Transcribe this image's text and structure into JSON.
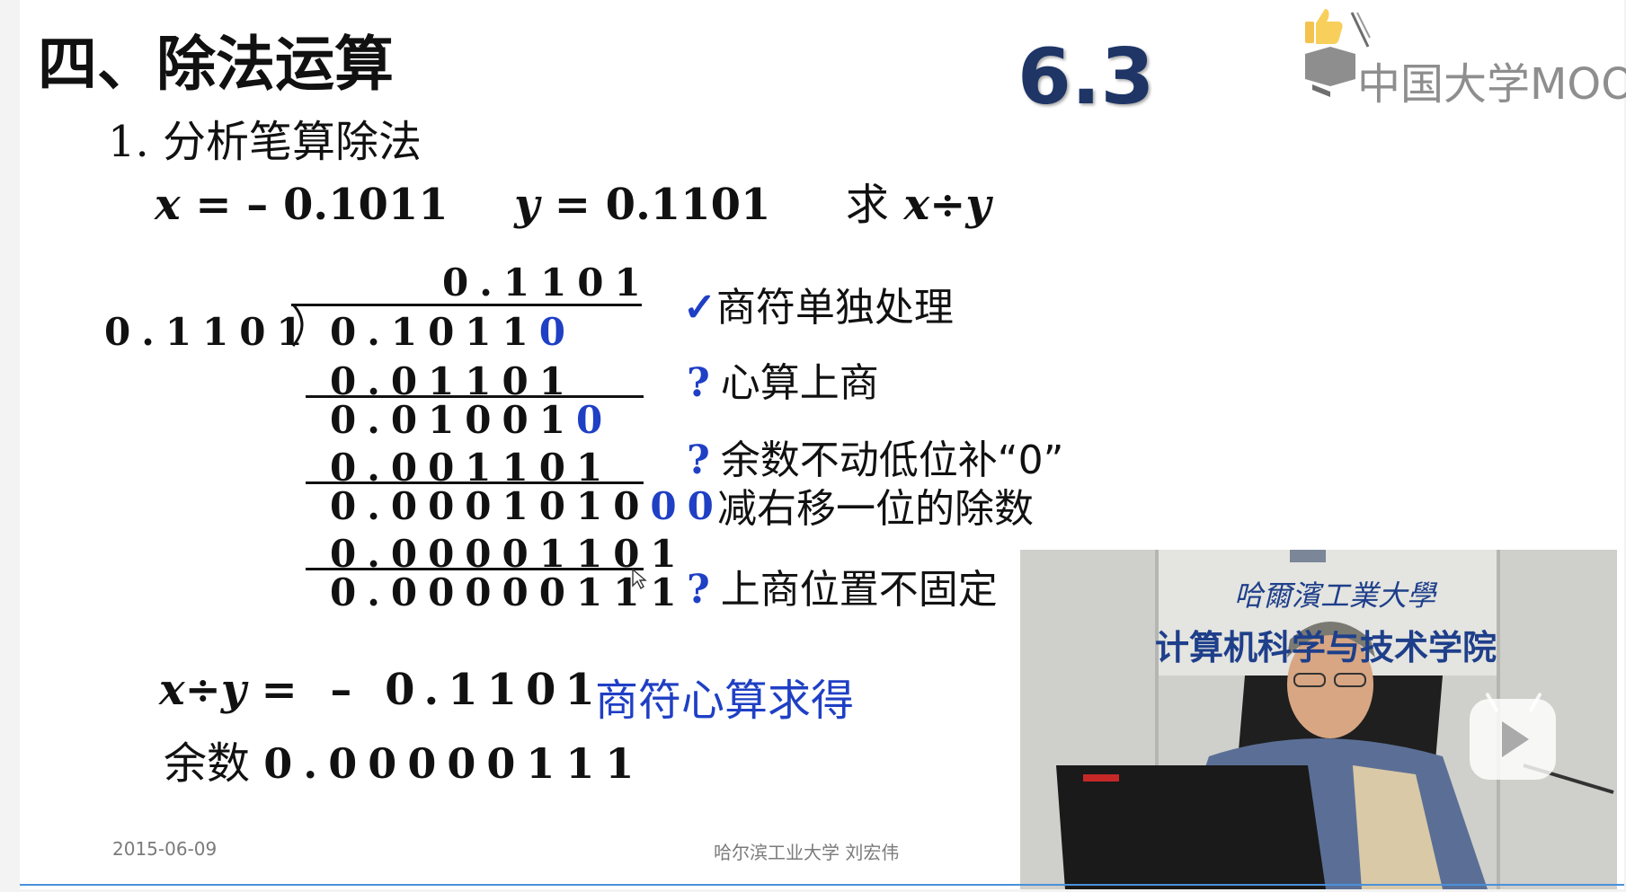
{
  "slide": {
    "title": "四、除法运算",
    "version": "6.3",
    "section": "1. 分析笔算除法",
    "problem": {
      "x_label": "x",
      "x_value": "= – 0.1011",
      "y_label": "y",
      "y_value": "= 0.1101",
      "ask": "求",
      "expr_x": "x",
      "div_sign": "÷",
      "expr_y": "y"
    },
    "division": {
      "divisor": "0.1101",
      "quotient": "0.1101",
      "rows": [
        {
          "text": "0.1011",
          "blue": "0"
        },
        {
          "text": "0.01101",
          "blue": ""
        },
        {
          "text": "0.01001",
          "blue": "0"
        },
        {
          "text": "0.001101",
          "blue": ""
        },
        {
          "text": "0.0001010",
          "blue": "00"
        },
        {
          "text": "0.00001101",
          "blue": ""
        },
        {
          "text": "0.00000111",
          "blue": ""
        }
      ]
    },
    "notes": [
      {
        "mark": "✓",
        "text": "商符单独处理"
      },
      {
        "mark": "?",
        "text": "心算上商"
      },
      {
        "mark": "?",
        "text": "余数不动低位补“0”"
      },
      {
        "mark": "",
        "text": "减右移一位的除数"
      },
      {
        "mark": "?",
        "text": "上商位置不固定"
      }
    ],
    "result": {
      "lhs_x": "x",
      "div_sign": "÷",
      "lhs_y": "y",
      "rhs": "= – 0.1101",
      "note": "商符心算求得",
      "remainder_label": "余数",
      "remainder_value": "0.00000111"
    },
    "footer": {
      "date": "2015-06-09",
      "author": "哈尔滨工业大学  刘宏伟"
    }
  },
  "overlay": {
    "brand": "中国大学MOOC",
    "video": {
      "school_sign": "哈爾濱工業大學",
      "college_sign": "计算机科学与技术学院"
    },
    "colors": {
      "accent_blue": "#1f3fc4",
      "version_color": "#1e3566",
      "progress_line": "#4a90d9"
    }
  }
}
